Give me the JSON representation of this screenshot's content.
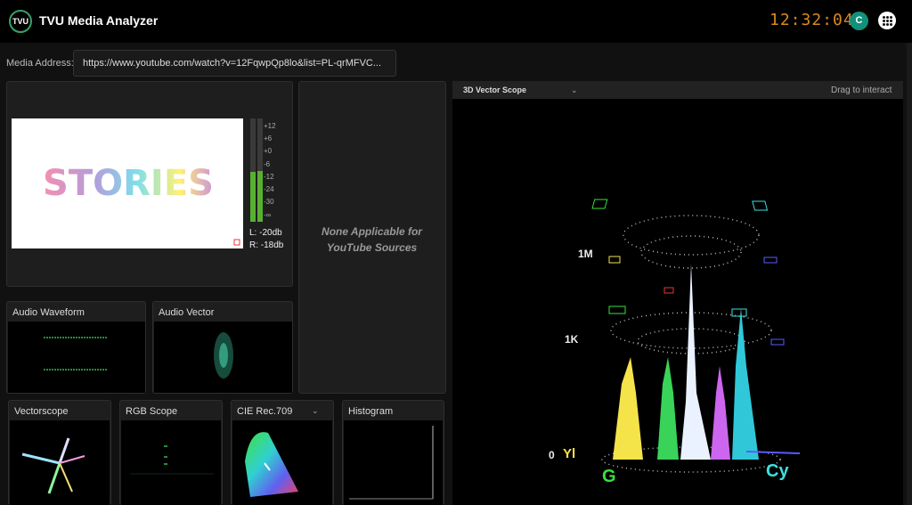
{
  "app": {
    "logo_text": "TVU",
    "title": "TVU Media Analyzer",
    "clock": "12:32:04",
    "user_initial": "C"
  },
  "address": {
    "label": "Media Address:",
    "value": "https://www.youtube.com/watch?v=12FqwpQp8lo&list=PL-qrMFVC..."
  },
  "preview": {
    "video_text": "STORIES"
  },
  "audio_meter": {
    "scale": [
      "+12",
      "+6",
      "+0",
      "-6",
      "-12",
      "-24",
      "-30",
      "-∞"
    ],
    "left_level": 0.48,
    "right_level": 0.49,
    "left_label": "L: -20db",
    "right_label": "R: -18db"
  },
  "middle_panel": {
    "line1": "None Applicable for",
    "line2": "YouTube Sources"
  },
  "panels": {
    "audio_waveform": "Audio Waveform",
    "audio_vector": "Audio Vector",
    "vectorscope": "Vectorscope",
    "rgb_scope": "RGB Scope",
    "cie": "CIE Rec.709",
    "histogram": "Histogram"
  },
  "vector_scope_3d": {
    "selected": "3D Vector Scope",
    "hint": "Drag to interact",
    "levels": [
      "1M",
      "1K",
      "0"
    ],
    "axis_labels": {
      "yl": "Yl",
      "g": "G",
      "cy": "Cy"
    }
  },
  "colors": {
    "accent": "#11907b",
    "clock": "#d98a1c",
    "meter": "#58b030"
  }
}
